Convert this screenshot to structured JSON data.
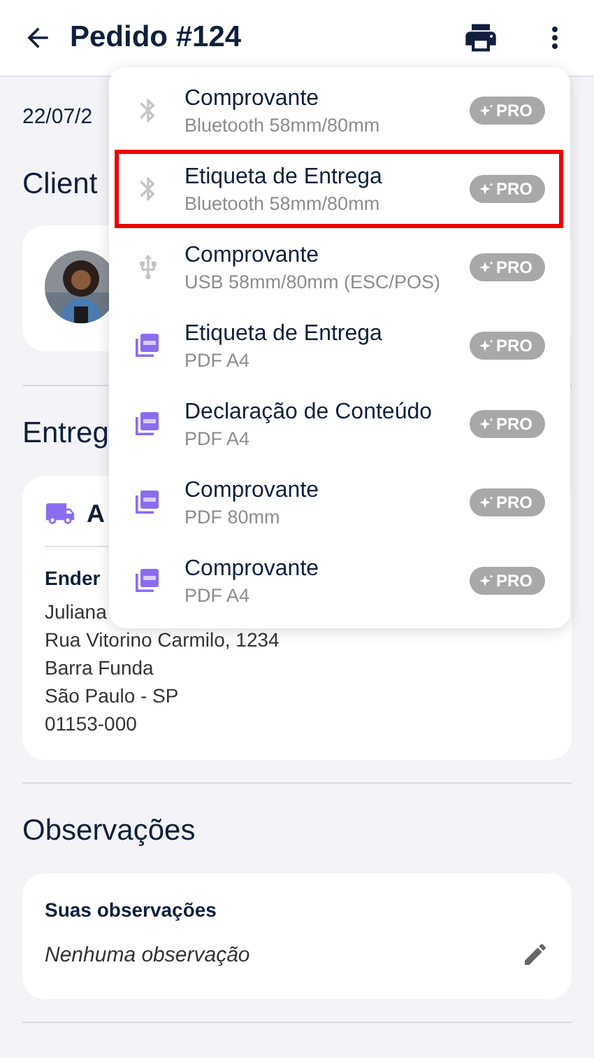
{
  "header": {
    "title": "Pedido #124"
  },
  "date": "22/07/2",
  "client": {
    "title": "Client"
  },
  "delivery": {
    "title": "Entreg",
    "status": "A",
    "address_label": "Ender",
    "address_lines": [
      "Juliana",
      "Rua Vitorino Carmilo, 1234",
      "Barra Funda",
      "São Paulo - SP",
      "01153-000"
    ]
  },
  "notes": {
    "title": "Observações",
    "label": "Suas observações",
    "value": "Nenhuma observação"
  },
  "print_menu": {
    "items": [
      {
        "kind": "bluetooth",
        "title": "Comprovante",
        "subtitle": "Bluetooth 58mm/80mm",
        "badge": "PRO",
        "selected": false
      },
      {
        "kind": "bluetooth",
        "title": "Etiqueta de Entrega",
        "subtitle": "Bluetooth 58mm/80mm",
        "badge": "PRO",
        "selected": true
      },
      {
        "kind": "usb",
        "title": "Comprovante",
        "subtitle": "USB 58mm/80mm (ESC/POS)",
        "badge": "PRO",
        "selected": false
      },
      {
        "kind": "pdf",
        "title": "Etiqueta de Entrega",
        "subtitle": "PDF A4",
        "badge": "PRO",
        "selected": false
      },
      {
        "kind": "pdf",
        "title": "Declaração de Conteúdo",
        "subtitle": "PDF A4",
        "badge": "PRO",
        "selected": false
      },
      {
        "kind": "pdf",
        "title": "Comprovante",
        "subtitle": "PDF 80mm",
        "badge": "PRO",
        "selected": false
      },
      {
        "kind": "pdf",
        "title": "Comprovante",
        "subtitle": "PDF A4",
        "badge": "PRO",
        "selected": false
      }
    ]
  }
}
